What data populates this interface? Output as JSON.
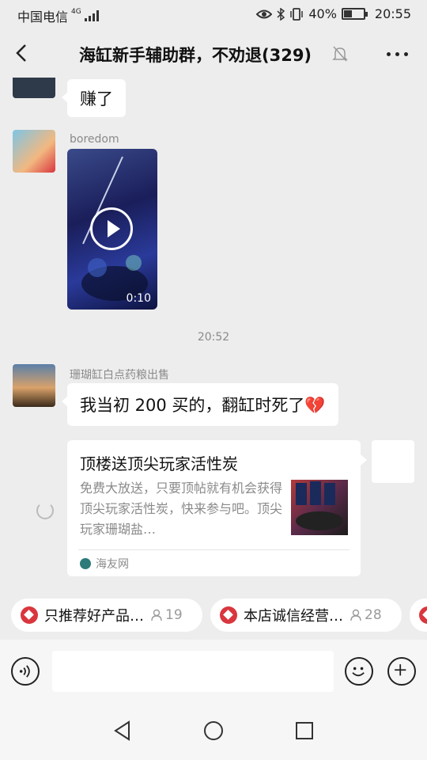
{
  "status_bar": {
    "carrier": "中国电信",
    "network": "4G",
    "battery": "40%",
    "battery_level": 0.4,
    "time": "20:55"
  },
  "header": {
    "title": "海缸新手辅助群，不劝退(329)",
    "icons": [
      "back-icon",
      "mute-bell-icon",
      "more-icon"
    ]
  },
  "messages": [
    {
      "type": "text",
      "text": "赚了"
    },
    {
      "type": "video",
      "sender": "boredom",
      "duration": "0:10"
    },
    {
      "type": "timestamp",
      "text": "20:52"
    },
    {
      "type": "text",
      "sender": "珊瑚缸白点药粮出售",
      "text": "我当初 200 买的，翻缸时死了💔"
    },
    {
      "type": "link_card",
      "title": "顶楼送顶尖玩家活性炭",
      "description": "免费大放送，只要顶帖就有机会获得顶尖玩家活性炭，快来参与吧。顶尖玩家珊瑚盐…",
      "source": "海友网"
    }
  ],
  "topics": [
    {
      "label": "只推荐好产品…",
      "count": "19"
    },
    {
      "label": "本店诚信经营…",
      "count": "28"
    }
  ],
  "input": {
    "placeholder": ""
  },
  "colors": {
    "background": "#ededed",
    "bubble": "#ffffff",
    "accent_red": "#d9363e",
    "meta_text": "#8a8a8a"
  }
}
